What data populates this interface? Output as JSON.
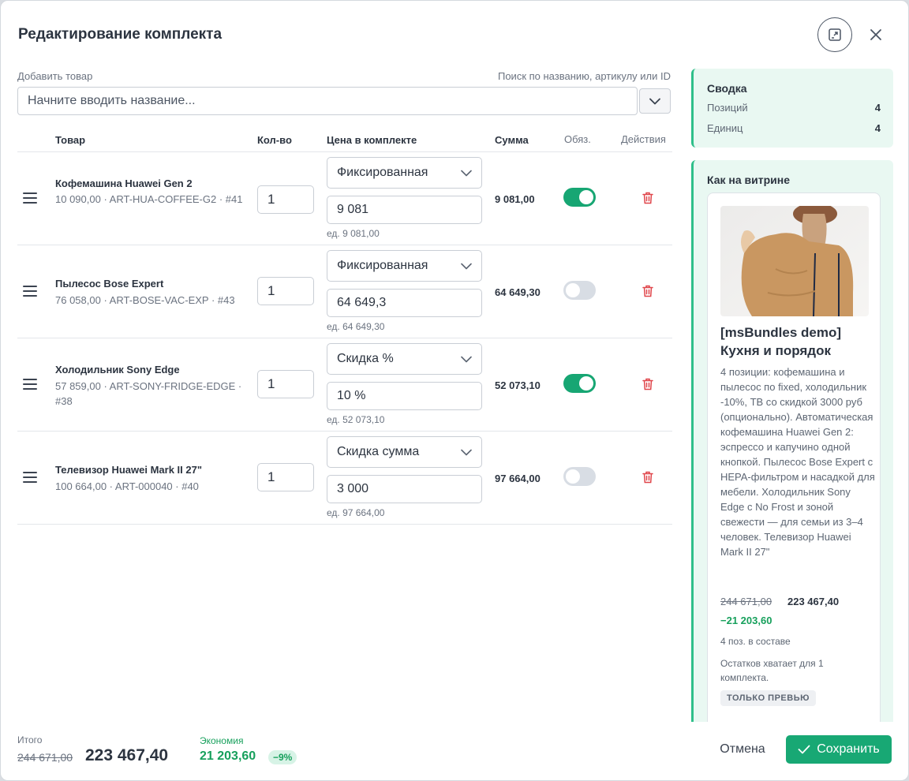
{
  "dialog": {
    "title": "Редактирование комплекта"
  },
  "add_product": {
    "label": "Добавить товар",
    "hint": "Поиск по названию, артикулу или ID",
    "placeholder": "Начните вводить название..."
  },
  "table": {
    "headers": {
      "product": "Товар",
      "qty": "Кол-во",
      "price": "Цена в комплекте",
      "sum": "Сумма",
      "required": "Обяз.",
      "actions": "Действия"
    },
    "rows": [
      {
        "name": "Кофемашина Huawei Gen 2",
        "meta": "10 090,00 · ART-HUA-COFFEE-G2 · #41",
        "qty": "1",
        "price_type": "Фиксированная",
        "price_value": "9 081",
        "unit_price": "ед. 9 081,00",
        "sum": "9 081,00",
        "required": true
      },
      {
        "name": "Пылесос Bose Expert",
        "meta": "76 058,00 · ART-BOSE-VAC-EXP · #43",
        "qty": "1",
        "price_type": "Фиксированная",
        "price_value": "64 649,3",
        "unit_price": "ед. 64 649,30",
        "sum": "64 649,30",
        "required": false
      },
      {
        "name": "Холодильник Sony Edge",
        "meta": "57 859,00 · ART-SONY-FRIDGE-EDGE · #38",
        "qty": "1",
        "price_type": "Скидка %",
        "price_value": "10 %",
        "unit_price": "ед. 52 073,10",
        "sum": "52 073,10",
        "required": true
      },
      {
        "name": "Телевизор Huawei Mark II 27\"",
        "meta": "100 664,00 · ART-000040 · #40",
        "qty": "1",
        "price_type": "Скидка сумма",
        "price_value": "3 000",
        "unit_price": "ед. 97 664,00",
        "sum": "97 664,00",
        "required": false
      }
    ]
  },
  "summary": {
    "title": "Сводка",
    "positions_label": "Позиций",
    "positions_value": "4",
    "units_label": "Единиц",
    "units_value": "4"
  },
  "showcase": {
    "title": "Как на витрине",
    "product_title": "[msBundles demo] Кухня и порядок",
    "description": "4 позиции: кофемашина и пылесос по fixed, холодильник -10%, ТВ со скидкой 3000 руб (опционально). Автоматическая кофемашина Huawei Gen 2: эспрессо и капучино одной кнопкой. Пылесос Bose Expert с HEPA-фильтром и насадкой для мебели. Холодильник Sony Edge с No Frost и зоной свежести — для семьи из 3–4 человек. Телевизор Huawei Mark II 27\"",
    "old_price": "244 671,00",
    "new_price": "223 467,40",
    "saving": "−21 203,60",
    "positions_text": "4 поз. в составе",
    "stock_text": "Остатков хватает для 1 комплекта.",
    "badge": "ТОЛЬКО ПРЕВЬЮ"
  },
  "footer": {
    "total_label": "Итого",
    "old_total": "244 671,00",
    "new_total": "223 467,40",
    "economy_label": "Экономия",
    "economy_value": "21 203,60",
    "economy_percent": "−9%",
    "cancel_label": "Отмена",
    "save_label": "Сохранить"
  },
  "colors": {
    "accent": "#18a874",
    "toggle_on": "#17a673",
    "toggle_off": "#d8dde4",
    "danger": "#e0464b",
    "panel_bg": "#e9f8f2"
  },
  "icons": [
    "expand-icon",
    "close-icon",
    "chevron-down-icon",
    "drag-handle-icon",
    "trash-icon",
    "check-icon"
  ]
}
